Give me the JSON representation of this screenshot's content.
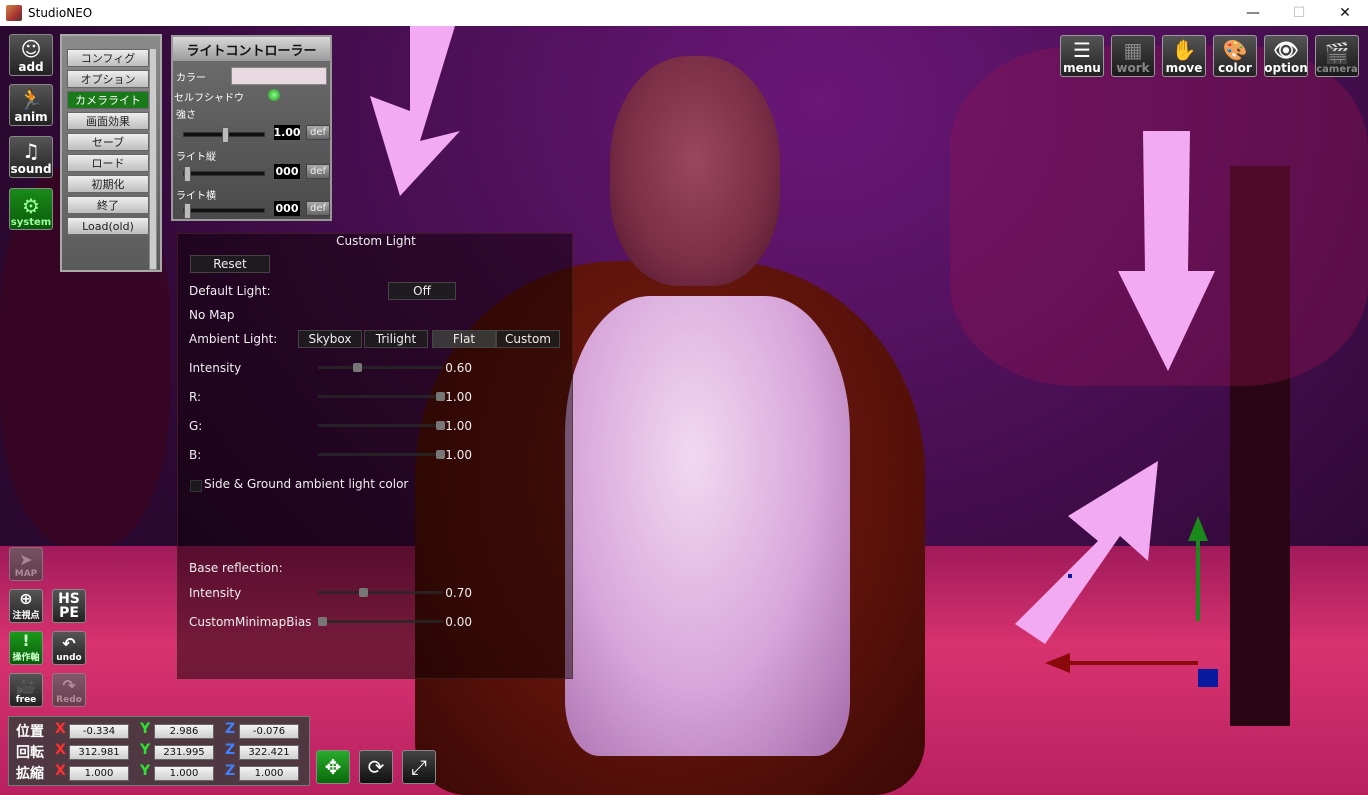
{
  "window": {
    "title": "StudioNEO",
    "controls": [
      "—",
      "☐",
      "✕"
    ]
  },
  "left_toolbar": [
    {
      "key": "add",
      "label": "add",
      "glyph": "☺",
      "icon": "person-add-icon"
    },
    {
      "key": "anim",
      "label": "anim",
      "glyph": "🏃",
      "icon": "running-figure-icon"
    },
    {
      "key": "sound",
      "label": "sound",
      "glyph": "♫",
      "icon": "music-note-icon"
    },
    {
      "key": "system",
      "label": "system",
      "glyph": "⚙",
      "icon": "gears-icon"
    }
  ],
  "system_menu": {
    "items": [
      "コンフィグ",
      "オプション",
      "カメラライト",
      "画面効果",
      "セーブ",
      "ロード",
      "初期化",
      "終了",
      "Load(old)"
    ],
    "active_index": 2
  },
  "light_controller": {
    "title": "ライトコントローラー",
    "color_label": "カラー",
    "self_shadow_label": "セルフシャドウ",
    "strength_label": "強さ",
    "strength_value": "1.00",
    "strength_level": 0.5,
    "vertical_label": "ライト縦",
    "vertical_value": "000",
    "horizontal_label": "ライト横",
    "horizontal_value": "000",
    "def_label": "def",
    "color": "#e8d8e0",
    "self_shadow_on": true
  },
  "custom_light": {
    "title": "Custom Light",
    "reset_label": "Reset",
    "default_light_label": "Default Light:",
    "default_light_value": "Off",
    "no_map_label": "No Map",
    "ambient_light_label": "Ambient Light:",
    "ambient_options": [
      "Skybox",
      "Trilight",
      "Flat",
      "Custom"
    ],
    "ambient_selected": "Flat",
    "sliders": [
      {
        "label": "Intensity",
        "value": "0.60",
        "fraction": 0.3
      },
      {
        "label": "R:",
        "value": "1.00",
        "fraction": 1.0
      },
      {
        "label": "G:",
        "value": "1.00",
        "fraction": 1.0
      },
      {
        "label": "B:",
        "value": "1.00",
        "fraction": 1.0
      }
    ],
    "side_ground_label": "Side & Ground ambient light color",
    "base_reflection_label": "Base reflection:",
    "reflection_sliders": [
      {
        "label": "Intensity",
        "value": "0.70",
        "fraction": 0.35
      },
      {
        "label": "CustomMinimapBias",
        "value": "0.00",
        "fraction": 0.0
      }
    ]
  },
  "top_toolbar": [
    {
      "label": "menu",
      "glyph": "☰",
      "icon": "menu-list-icon",
      "dim": false
    },
    {
      "label": "work",
      "glyph": "▦",
      "icon": "work-folder-icon",
      "dim": true
    },
    {
      "label": "move",
      "glyph": "✋",
      "icon": "hand-icon",
      "dim": false
    },
    {
      "label": "color",
      "glyph": "🎨",
      "icon": "palette-icon",
      "dim": false
    },
    {
      "label": "option",
      "glyph": "👁",
      "icon": "eye-icon",
      "dim": false
    },
    {
      "label": "camera",
      "glyph": "🎬",
      "icon": "clapperboard-icon",
      "dim": true
    }
  ],
  "bottom_left_icons": [
    {
      "label": "MAP",
      "glyph": "➤",
      "icon": "map-arrow-icon",
      "style": "dim"
    },
    {
      "label": "注視点",
      "glyph": "⊕",
      "icon": "crosshair-plus-icon",
      "style": "normal"
    },
    {
      "label": "HS PE",
      "glyph": "",
      "icon": "hspe-icon",
      "style": "normal"
    },
    {
      "label": "操作軸",
      "glyph": "!",
      "icon": "axis-icon",
      "style": "green"
    },
    {
      "label": "undo",
      "glyph": "↶",
      "icon": "undo-icon",
      "style": "normal"
    },
    {
      "label": "free",
      "glyph": "🎥",
      "icon": "video-camera-icon",
      "style": "normal"
    },
    {
      "label": "Redo",
      "glyph": "↷",
      "icon": "redo-icon",
      "style": "dim"
    }
  ],
  "transform": {
    "rows": [
      {
        "label": "位置",
        "x": "-0.334",
        "y": "2.986",
        "z": "-0.076"
      },
      {
        "label": "回転",
        "x": "312.981",
        "y": "231.995",
        "z": "322.421"
      },
      {
        "label": "拡縮",
        "x": "1.000",
        "y": "1.000",
        "z": "1.000"
      }
    ],
    "axis_x": "X",
    "axis_y": "Y",
    "axis_z": "Z",
    "colors": {
      "x": "#ff3030",
      "y": "#30e030",
      "z": "#4080ff"
    }
  },
  "gizmo_buttons": [
    {
      "glyph": "✥",
      "icon": "move-arrows-icon",
      "active": true
    },
    {
      "glyph": "⟳",
      "icon": "rotate-icon",
      "active": false
    },
    {
      "glyph": "⤢",
      "icon": "scale-expand-icon",
      "active": false
    }
  ]
}
